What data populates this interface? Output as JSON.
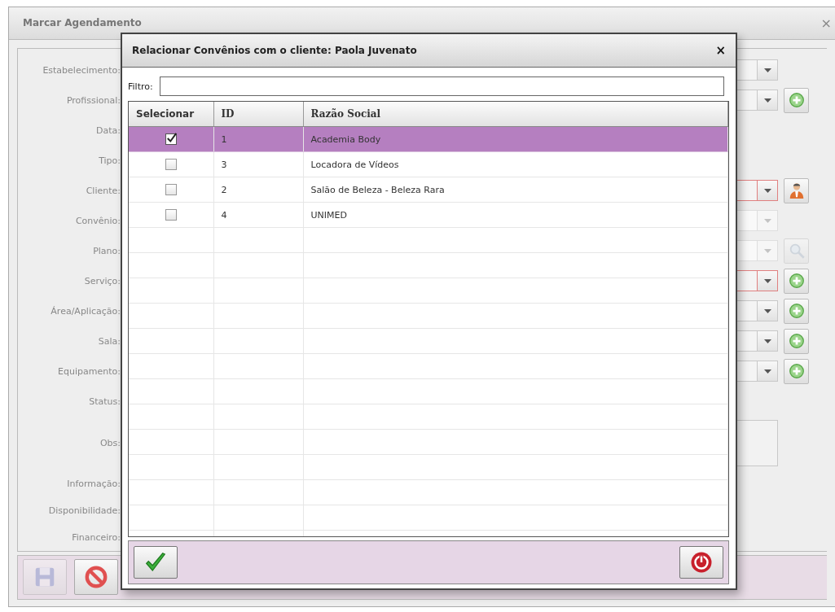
{
  "window": {
    "title": "Marcar Agendamento",
    "close": "×"
  },
  "form": {
    "fields": [
      {
        "label": "Estabelecimento:",
        "kind": "combo",
        "error": false,
        "disabled": false
      },
      {
        "label": "Profissional:",
        "kind": "combo",
        "error": false,
        "disabled": false,
        "action": {
          "kind": "add"
        }
      },
      {
        "label": "Data:",
        "kind": "none"
      },
      {
        "label": "Tipo:",
        "kind": "none"
      },
      {
        "label": "Cliente:",
        "kind": "combo",
        "error": true,
        "disabled": false,
        "action": {
          "kind": "person"
        }
      },
      {
        "label": "Convênio:",
        "kind": "combo",
        "error": false,
        "disabled": true
      },
      {
        "label": "Plano:",
        "kind": "combo",
        "error": false,
        "disabled": true,
        "action": {
          "kind": "search"
        }
      },
      {
        "label": "Serviço:",
        "kind": "combo",
        "error": true,
        "disabled": false,
        "action": {
          "kind": "add"
        }
      },
      {
        "label": "Área/Aplicação:",
        "kind": "combo",
        "error": false,
        "disabled": false,
        "action": {
          "kind": "add"
        }
      },
      {
        "label": "Sala:",
        "kind": "combo",
        "error": false,
        "disabled": false,
        "action": {
          "kind": "add"
        }
      },
      {
        "label": "Equipamento:",
        "kind": "combo",
        "error": false,
        "disabled": false,
        "action": {
          "kind": "add"
        }
      },
      {
        "label": "Status:",
        "kind": "none"
      },
      {
        "label": "Obs:",
        "kind": "textarea"
      },
      {
        "label": "Informação:",
        "kind": "none"
      },
      {
        "label": "Disponibilidade:",
        "kind": "none"
      },
      {
        "label": "Financeiro:",
        "kind": "none"
      }
    ]
  },
  "toolbar": [
    {
      "kind": "save",
      "disabled": true
    },
    {
      "kind": "cancel",
      "disabled": false
    }
  ],
  "dialog": {
    "title": "Relacionar Convênios com o cliente: Paola Juvenato",
    "close": "×",
    "filter": {
      "label": "Filtro:"
    },
    "columns": [
      "Selecionar",
      "ID",
      "Razão Social"
    ],
    "rows": [
      {
        "checked": true,
        "selected": true,
        "id": "1",
        "name": "Academia Body"
      },
      {
        "checked": false,
        "selected": false,
        "id": "3",
        "name": "Locadora de Vídeos"
      },
      {
        "checked": false,
        "selected": false,
        "id": "2",
        "name": "Salão de Beleza - Beleza Rara"
      },
      {
        "checked": false,
        "selected": false,
        "id": "4",
        "name": "UNIMED"
      }
    ],
    "buttons": [
      {
        "kind": "confirm"
      },
      {
        "kind": "close"
      }
    ]
  }
}
